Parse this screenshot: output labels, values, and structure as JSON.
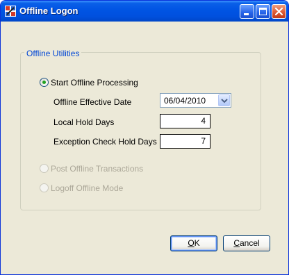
{
  "window": {
    "title": "Offline Logon",
    "colors": {
      "titlebar": "#0054e3",
      "face": "#ece9d8",
      "group_title": "#0046d5",
      "radio_dot": "#21a121"
    }
  },
  "titlebar_buttons": {
    "minimize_icon": "minimize-icon",
    "maximize_icon": "maximize-icon",
    "close_icon": "close-icon"
  },
  "group": {
    "title": "Offline Utilities"
  },
  "options": {
    "start": {
      "label": "Start Offline Processing",
      "selected": true,
      "enabled": true
    },
    "post": {
      "label": "Post Offline Transactions",
      "selected": false,
      "enabled": false
    },
    "logoff": {
      "label": "Logoff Offline Mode",
      "selected": false,
      "enabled": false
    }
  },
  "fields": {
    "effective_date": {
      "label": "Offline Effective Date",
      "value": "06/04/2010"
    },
    "local_hold_days": {
      "label": "Local Hold Days",
      "value": "4"
    },
    "exception_hold_days": {
      "label": "Exception Check Hold Days",
      "value": "7"
    }
  },
  "buttons": {
    "ok": {
      "accel": "O",
      "rest": "K"
    },
    "cancel": {
      "accel": "C",
      "rest": "ancel"
    }
  }
}
